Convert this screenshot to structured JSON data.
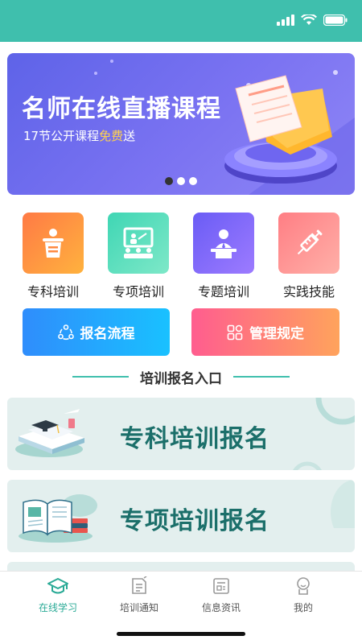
{
  "banner": {
    "title": "名师在线直播课程",
    "subtitle_prefix": "17节公开课程",
    "subtitle_highlight": "免费",
    "subtitle_suffix": "送",
    "slide_count": 3,
    "active_slide": 1
  },
  "categories": [
    {
      "label": "专科培训",
      "icon": "podium-icon",
      "color_from": "#ff7a45",
      "color_to": "#ffb23e"
    },
    {
      "label": "专项培训",
      "icon": "classroom-icon",
      "color_from": "#3fd6b4",
      "color_to": "#7ee8c8"
    },
    {
      "label": "专题培训",
      "icon": "speaker-icon",
      "color_from": "#6a5cf5",
      "color_to": "#9d7bff"
    },
    {
      "label": "实践技能",
      "icon": "syringe-icon",
      "color_from": "#ff7e84",
      "color_to": "#ffb0a8"
    }
  ],
  "actions": {
    "process_label": "报名流程",
    "rules_label": "管理规定"
  },
  "section": {
    "title": "培训报名入口"
  },
  "registration": [
    {
      "label": "专科培训报名",
      "icon": "books-graduation-icon"
    },
    {
      "label": "专项培训报名",
      "icon": "open-book-icon"
    }
  ],
  "tabbar": [
    {
      "label": "在线学习",
      "icon": "graduation-cap-icon",
      "active": true
    },
    {
      "label": "培训通知",
      "icon": "notice-icon",
      "active": false
    },
    {
      "label": "信息资讯",
      "icon": "news-icon",
      "active": false
    },
    {
      "label": "我的",
      "icon": "profile-icon",
      "active": false
    }
  ],
  "colors": {
    "accent": "#3fbfad",
    "tab_active": "#2aaa96",
    "card_bg": "#e3efee",
    "card_text": "#1b6f6a"
  }
}
